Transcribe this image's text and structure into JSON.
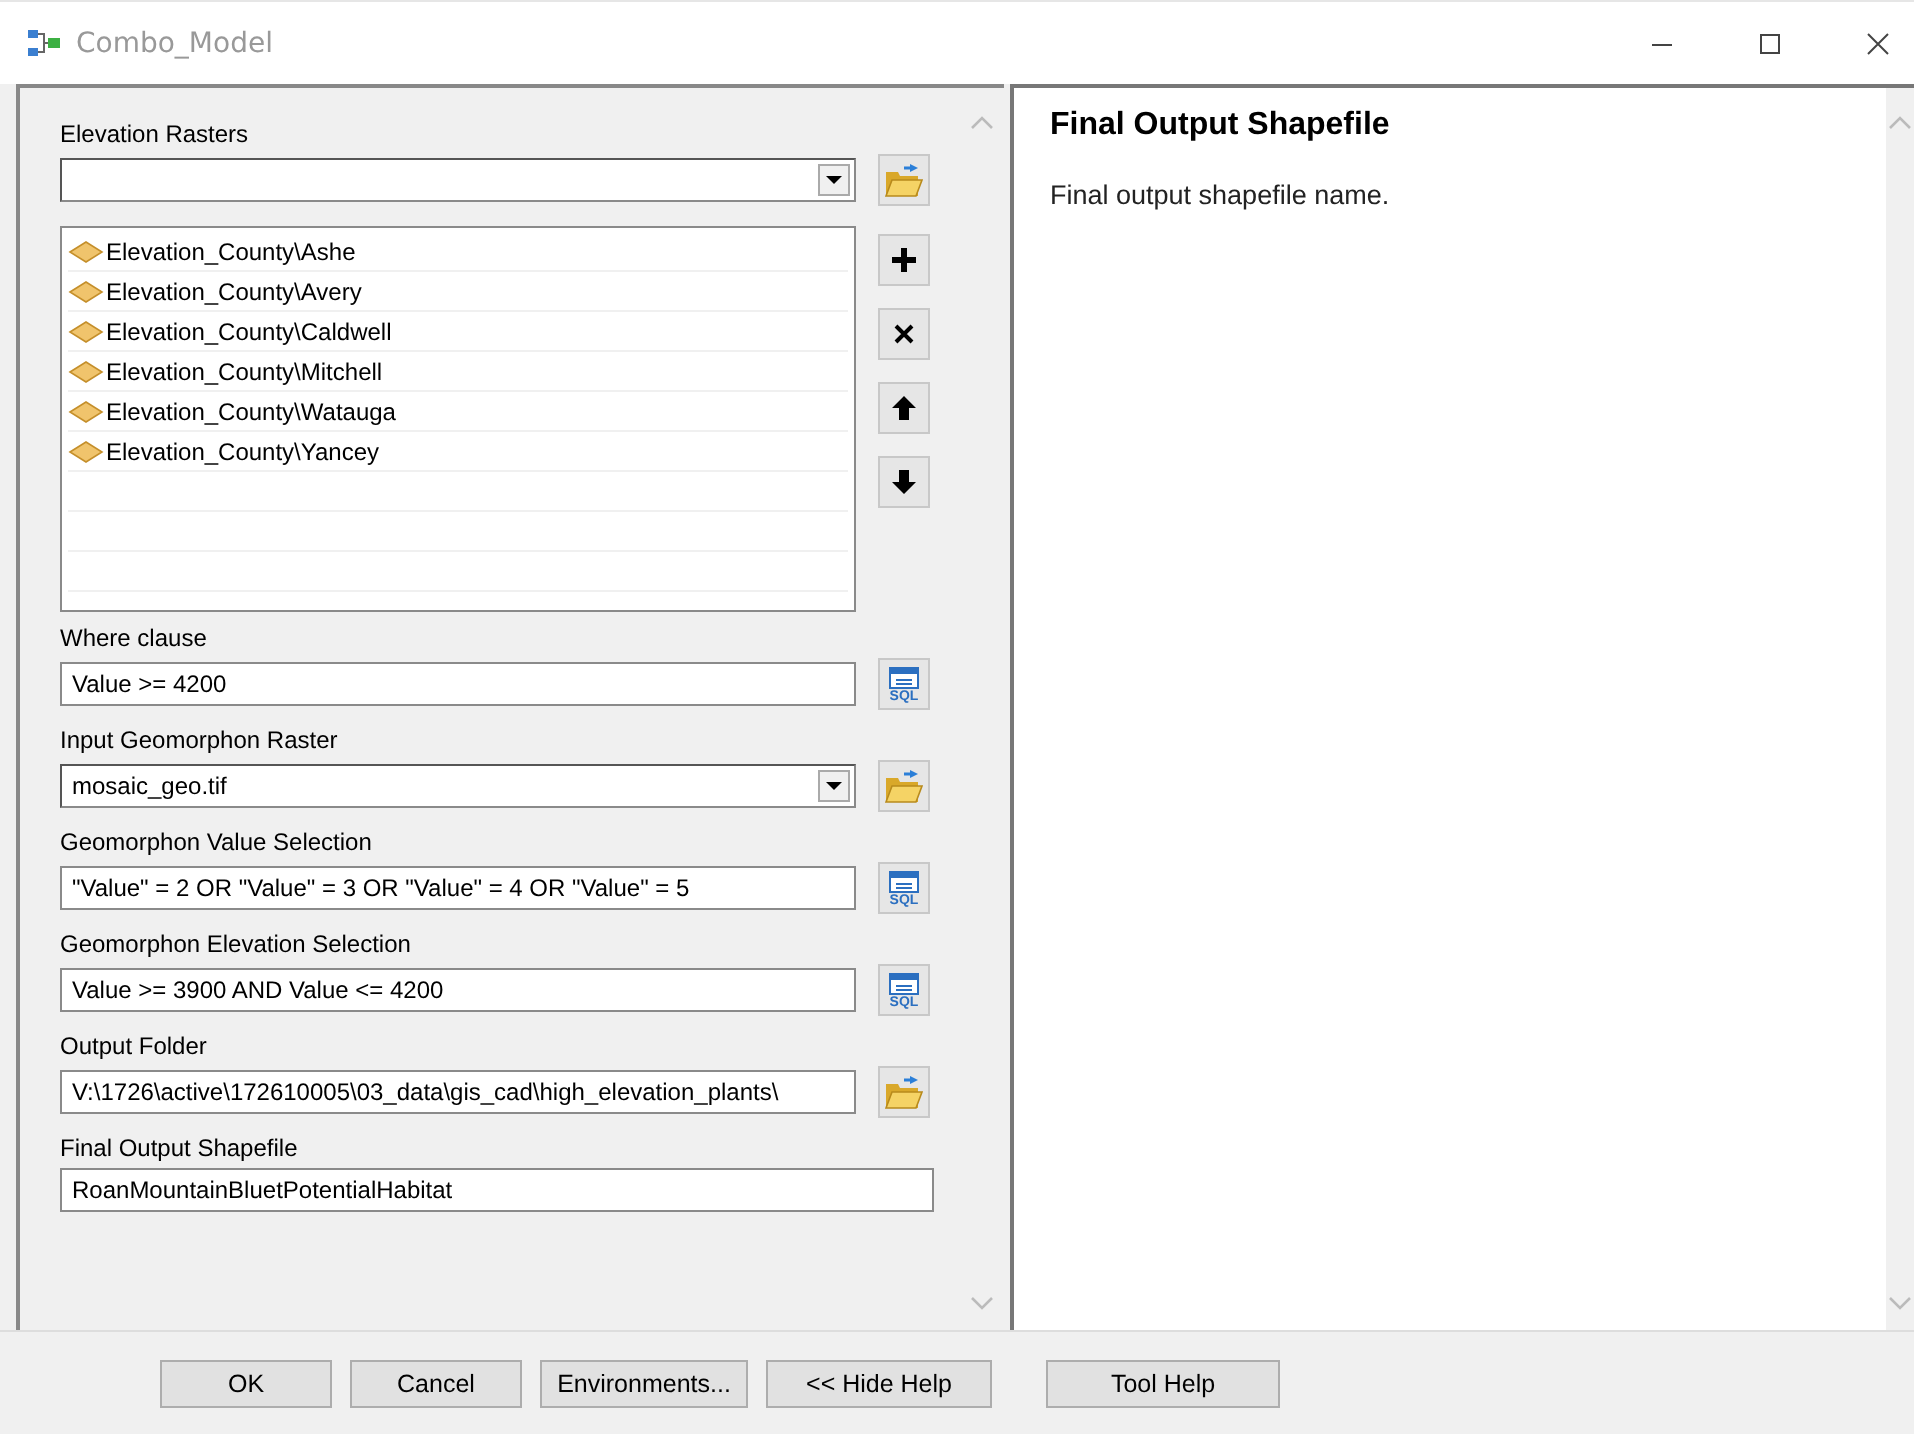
{
  "window": {
    "title": "Combo_Model"
  },
  "parameters": [
    {
      "kind": "multivalue",
      "label": "Elevation Rasters",
      "items": [
        "Elevation_County\\Ashe",
        "Elevation_County\\Avery",
        "Elevation_County\\Caldwell",
        "Elevation_County\\Mitchell",
        "Elevation_County\\Watauga",
        "Elevation_County\\Yancey"
      ]
    },
    {
      "kind": "sql",
      "label": "Where clause",
      "value": "Value >= 4200",
      "icon_label": "SQL"
    },
    {
      "kind": "dropdown",
      "label": "Input Geomorphon Raster",
      "value": "mosaic_geo.tif"
    },
    {
      "kind": "sql",
      "label": "Geomorphon Value Selection",
      "value": "\"Value\" = 2 OR \"Value\" = 3 OR \"Value\" = 4 OR \"Value\" = 5",
      "icon_label": "SQL"
    },
    {
      "kind": "sql",
      "label": "Geomorphon Elevation Selection",
      "value": "Value >= 3900 AND Value <= 4200",
      "icon_label": "SQL"
    },
    {
      "kind": "folder",
      "label": "Output Folder",
      "value": "V:\\1726\\active\\172610005\\03_data\\gis_cad\\high_elevation_plants\\"
    },
    {
      "kind": "text",
      "label": "Final Output Shapefile",
      "value": "RoanMountainBluetPotentialHabitat"
    }
  ],
  "help": {
    "title": "Final Output Shapefile",
    "text": "Final output shapefile name."
  },
  "buttons": [
    "OK",
    "Cancel",
    "Environments...",
    "<< Hide Help",
    "Tool Help"
  ]
}
